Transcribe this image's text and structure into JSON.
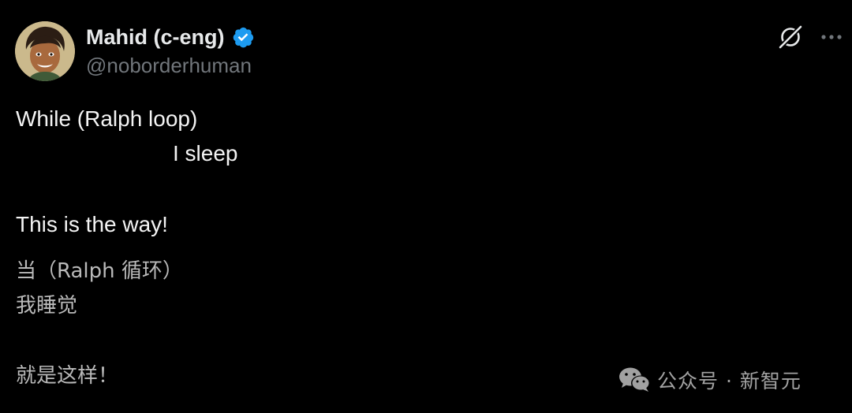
{
  "author": {
    "display_name": "Mahid (c-eng)",
    "handle": "@noborderhuman",
    "verified": true,
    "verified_color": "#1d9bf0"
  },
  "header_icons": {
    "grok": "grok-icon",
    "more": "more-icon"
  },
  "tweet": {
    "line1": "While (Ralph loop)",
    "line2": "I sleep",
    "line3": "This is the way!"
  },
  "translation": {
    "line1": "当（Ralph 循环）",
    "line2": "我睡觉",
    "line3": "就是这样！"
  },
  "watermark": {
    "logo": "wechat-icon",
    "text": "公众号 · 新智元"
  },
  "colors": {
    "background": "#000000",
    "primary_text": "#e7e9ea",
    "secondary_text": "#71767b"
  }
}
